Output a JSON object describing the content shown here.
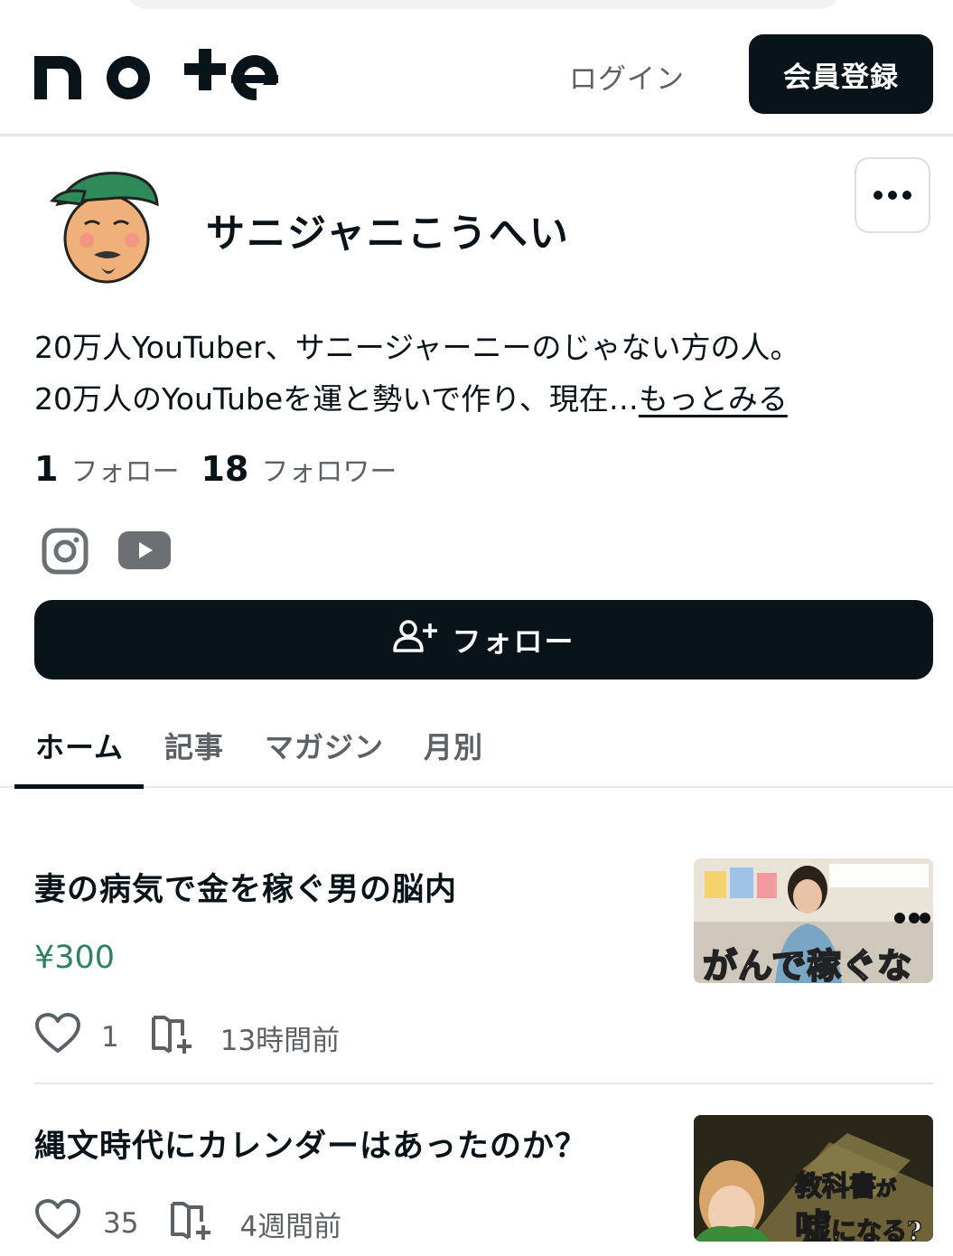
{
  "header": {
    "logo_text": "note",
    "login_label": "ログイン",
    "register_label": "会員登録"
  },
  "profile": {
    "name": "サニジャニこうへい",
    "bio_line1": "20万人YouTuber、サニージャーニーのじゃない方の人。",
    "bio_line2": "20万人のYouTubeを運と勢いで作り、現在…",
    "bio_more": "もっとみる",
    "follow_count": "1",
    "follow_label": "フォロー",
    "follower_count": "18",
    "follower_label": "フォロワー",
    "follow_button": "フォロー"
  },
  "tabs": [
    {
      "label": "ホーム"
    },
    {
      "label": "記事"
    },
    {
      "label": "マガジン"
    },
    {
      "label": "月別"
    }
  ],
  "articles": [
    {
      "title": "妻の病気で金を稼ぐ男の脳内",
      "price": "¥300",
      "likes": "1",
      "time": "13時間前",
      "thumb_caption": "がんで稼ぐな"
    },
    {
      "title": "縄文時代にカレンダーはあったのか？",
      "likes": "35",
      "time": "4週間前",
      "thumb_caption_1": "教科書",
      "thumb_caption_2": "が",
      "thumb_caption_3": "嘘",
      "thumb_caption_4": "になる?"
    }
  ],
  "colors": {
    "primary": "#08131a",
    "muted": "#5b6166",
    "price": "#2e8066",
    "avatar_cap": "#2f8a5a"
  },
  "icons": [
    "note-logo",
    "more-icon",
    "instagram-icon",
    "youtube-icon",
    "add-user-icon",
    "heart-icon",
    "magazine-add-icon"
  ]
}
